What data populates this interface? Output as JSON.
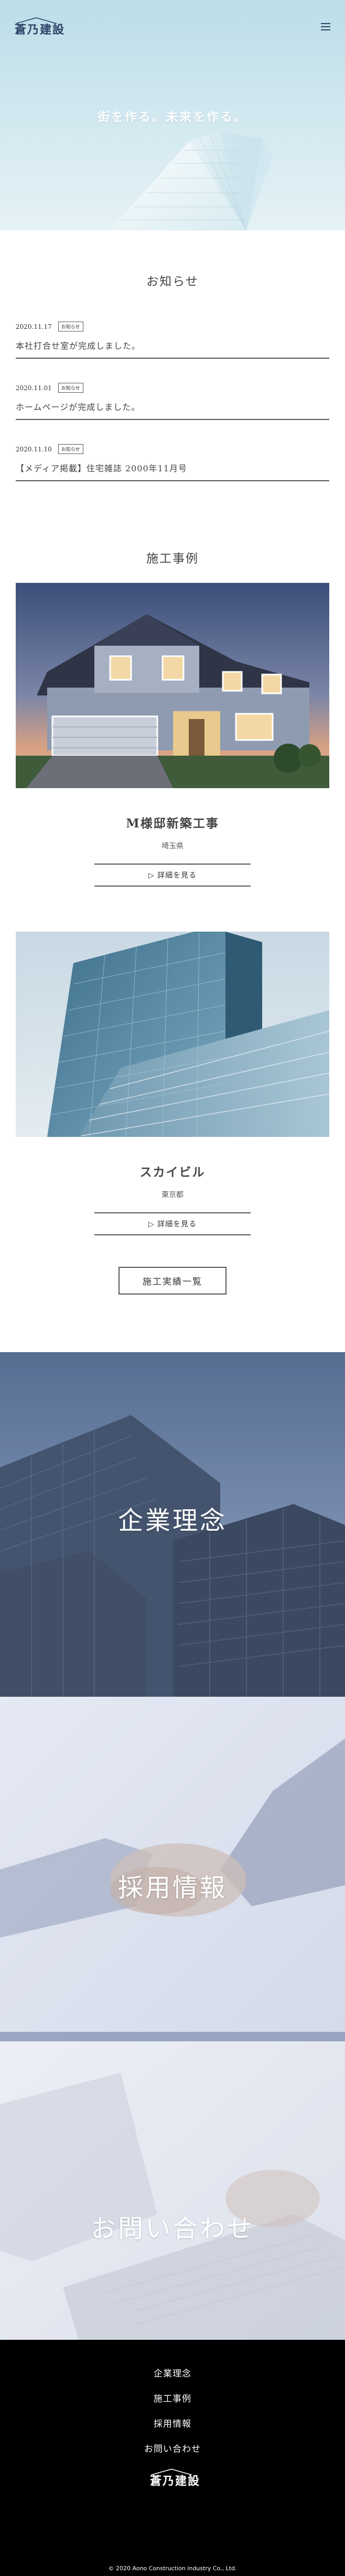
{
  "brand": {
    "name": "蒼乃建設"
  },
  "hero": {
    "catch": "街を作る。未来を作る。"
  },
  "news": {
    "title": "お知らせ",
    "items": [
      {
        "date": "2020.11.17",
        "tag": "お知らせ",
        "text": "本社打合せ室が完成しました。"
      },
      {
        "date": "2020.11.01",
        "tag": "お知らせ",
        "text": "ホームページが完成しました。"
      },
      {
        "date": "2020.11.10",
        "tag": "お知らせ",
        "text": "【メディア掲載】住宅雑誌 2000年11月号"
      }
    ]
  },
  "works": {
    "title": "施工事例",
    "items": [
      {
        "title": "M様邸新築工事",
        "place": "埼玉県",
        "button": "▷ 詳細を見る"
      },
      {
        "title": "スカイビル",
        "place": "東京都",
        "button": "▷ 詳細を見る"
      }
    ],
    "all_button": "施工実績一覧"
  },
  "banners": {
    "philosophy": "企業理念",
    "recruit": "採用情報",
    "contact": "お問い合わせ"
  },
  "footer": {
    "nav": [
      "企業理念",
      "施工事例",
      "採用情報",
      "お問い合わせ"
    ],
    "copyright": "© 2020 Aono Construction industry Co., Ltd."
  }
}
